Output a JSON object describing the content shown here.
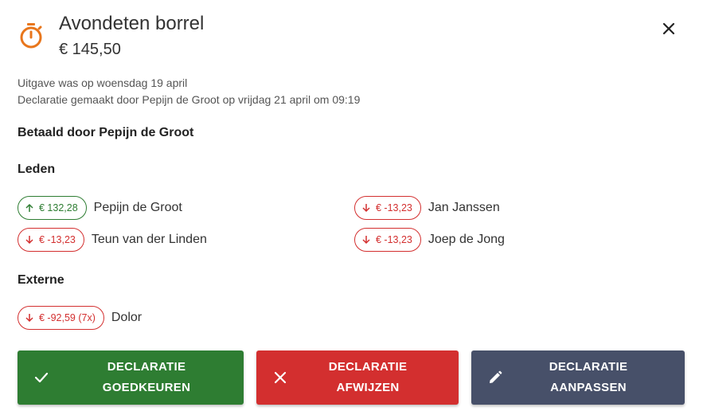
{
  "header": {
    "icon": "stopwatch-icon",
    "title": "Avondeten borrel",
    "amount": "€ 145,50",
    "close_icon": "close-icon"
  },
  "meta": {
    "expense_date": "Uitgave was op woensdag 19 april",
    "declaration_info": "Declaratie gemaakt door Pepijn de Groot op vrijdag 21 april om 09:19"
  },
  "paid_by": "Betaald door Pepijn de Groot",
  "members": {
    "heading": "Leden",
    "items": [
      {
        "amount": "€ 132,28",
        "name": "Pepijn de Groot",
        "direction": "up"
      },
      {
        "amount": "€ -13,23",
        "name": "Jan Janssen",
        "direction": "down"
      },
      {
        "amount": "€ -13,23",
        "name": "Teun van der Linden",
        "direction": "down"
      },
      {
        "amount": "€ -13,23",
        "name": "Joep de Jong",
        "direction": "down"
      }
    ]
  },
  "externals": {
    "heading": "Externe",
    "items": [
      {
        "amount": "€ -92,59 (7x)",
        "name": "Dolor",
        "direction": "down"
      }
    ]
  },
  "actions": {
    "approve": {
      "line1": "DECLARATIE",
      "line2": "GOEDKEUREN",
      "icon": "check-icon"
    },
    "reject": {
      "line1": "DECLARATIE",
      "line2": "AFWIJZEN",
      "icon": "close-icon"
    },
    "edit": {
      "line1": "DECLARATIE",
      "line2": "AANPASSEN",
      "icon": "pencil-icon"
    }
  },
  "colors": {
    "accent_orange": "#e8761c",
    "positive": "#2e7d32",
    "negative": "#d32f2f",
    "edit": "#475069"
  }
}
